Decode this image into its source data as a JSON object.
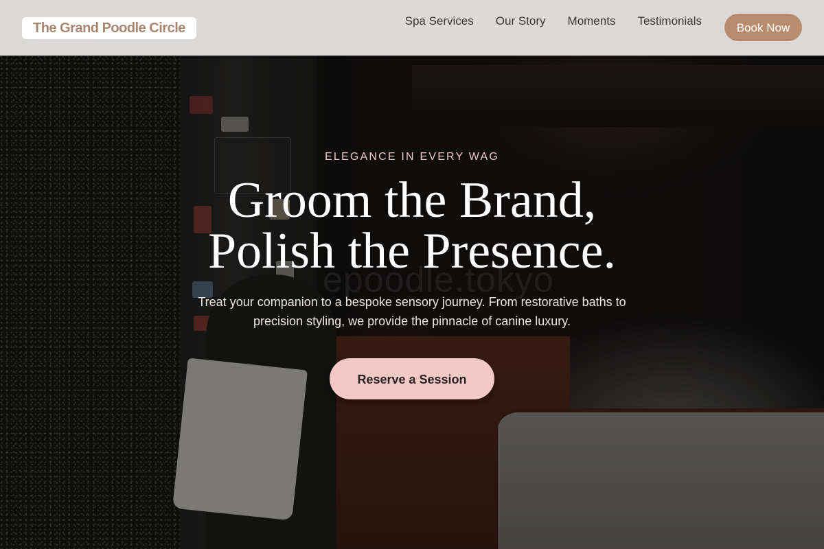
{
  "header": {
    "logo_text": "The Grand Poodle Circle",
    "nav": [
      {
        "label": "Spa Services"
      },
      {
        "label": "Our Story"
      },
      {
        "label": "Moments"
      },
      {
        "label": "Testimonials"
      }
    ],
    "book_label": "Book Now"
  },
  "hero": {
    "eyebrow": "ELEGANCE IN EVERY WAG",
    "headline_line1": "Groom the Brand,",
    "headline_line2": "Polish the Presence.",
    "subtext": "Treat your companion to a bespoke sensory journey. From restorative baths to precision styling, we provide the pinnacle of canine luxury.",
    "cta_label": "Reserve a Session",
    "background_watermark": "epoodle.tokyo"
  },
  "colors": {
    "brand": "#a98670",
    "book_button": "#b98c6e",
    "cta": "#f3c9c7",
    "eyebrow": "#f1c9c6",
    "header_bg": "#eceae8"
  }
}
